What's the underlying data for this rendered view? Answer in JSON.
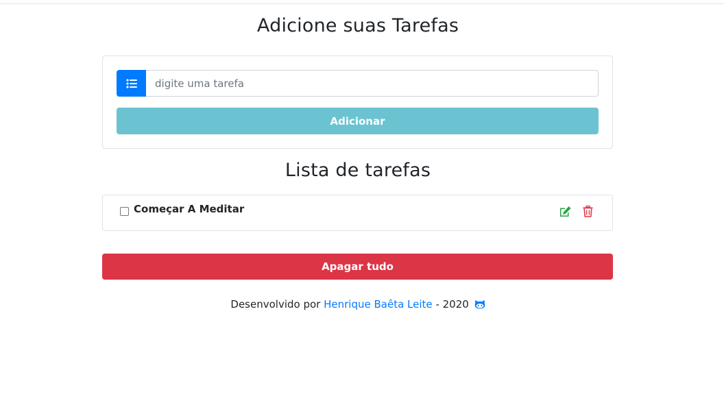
{
  "header": {
    "title": "Adicione suas Tarefas"
  },
  "form": {
    "icon": "list-icon",
    "input_placeholder": "digite uma tarefa",
    "input_value": "",
    "add_label": "Adicionar",
    "colors": {
      "addon": "#007bff",
      "add_button": "#6bc3d1"
    }
  },
  "list": {
    "title": "Lista de tarefas",
    "items": [
      {
        "label": "Começar A Meditar",
        "checked": false,
        "actions": [
          "edit-icon",
          "trash-icon"
        ]
      }
    ]
  },
  "clear": {
    "label": "Apagar tudo",
    "color": "#dc3545"
  },
  "footer": {
    "prefix": "Desenvolvido por",
    "author": "Henrique Baêta Leite",
    "suffix": "- 2020",
    "icon": "github-icon"
  }
}
